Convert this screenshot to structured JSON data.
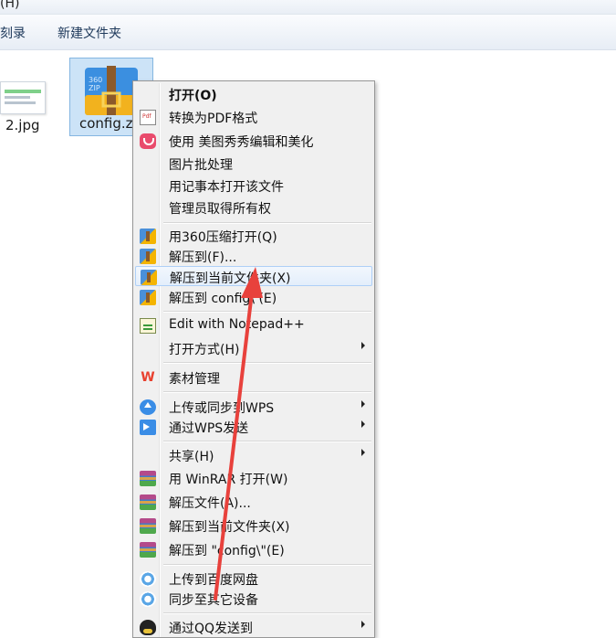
{
  "menubar": {
    "fragment": "(H)"
  },
  "toolbar": {
    "burn_label": "刻录",
    "new_folder_label": "新建文件夹"
  },
  "files": [
    {
      "name": "2.jpg"
    },
    {
      "name": "config.z"
    }
  ],
  "context_menu": {
    "items": [
      {
        "label": "打开(O)",
        "icon": ""
      },
      {
        "label": "转换为PDF格式",
        "icon": "pdf-icon"
      },
      {
        "label": "使用 美图秀秀编辑和美化",
        "icon": "meitu-icon"
      },
      {
        "label": "图片批处理",
        "icon": ""
      },
      {
        "label": "用记事本打开该文件",
        "icon": ""
      },
      {
        "label": "管理员取得所有权",
        "icon": ""
      },
      {
        "label": "用360压缩打开(Q)",
        "icon": "360zip-icon"
      },
      {
        "label": "解压到(F)...",
        "icon": "360zip-icon"
      },
      {
        "label": "解压到当前文件夹(X)",
        "icon": "360zip-icon"
      },
      {
        "label": "解压到 config\\ (E)",
        "icon": "360zip-icon"
      },
      {
        "label": "Edit with Notepad++",
        "icon": "notepad-icon"
      },
      {
        "label": "打开方式(H)",
        "icon": ""
      },
      {
        "label": "素材管理",
        "icon": "wps-icon"
      },
      {
        "label": "上传或同步到WPS",
        "icon": "upload-icon"
      },
      {
        "label": "通过WPS发送",
        "icon": "send-icon"
      },
      {
        "label": "共享(H)",
        "icon": ""
      },
      {
        "label": "用 WinRAR 打开(W)",
        "icon": "winrar-icon"
      },
      {
        "label": "解压文件(A)...",
        "icon": "winrar-icon"
      },
      {
        "label": "解压到当前文件夹(X)",
        "icon": "winrar-icon"
      },
      {
        "label": "解压到 \"config\\\"(E)",
        "icon": "winrar-icon"
      },
      {
        "label": "上传到百度网盘",
        "icon": "baidu-icon"
      },
      {
        "label": "同步至其它设备",
        "icon": "baidu-icon"
      },
      {
        "label": "通过QQ发送到",
        "icon": "qq-icon"
      }
    ]
  },
  "colors": {
    "selection": "#cce3f7",
    "arrow": "#e8413c",
    "menu_bg": "#f0f0f0"
  }
}
